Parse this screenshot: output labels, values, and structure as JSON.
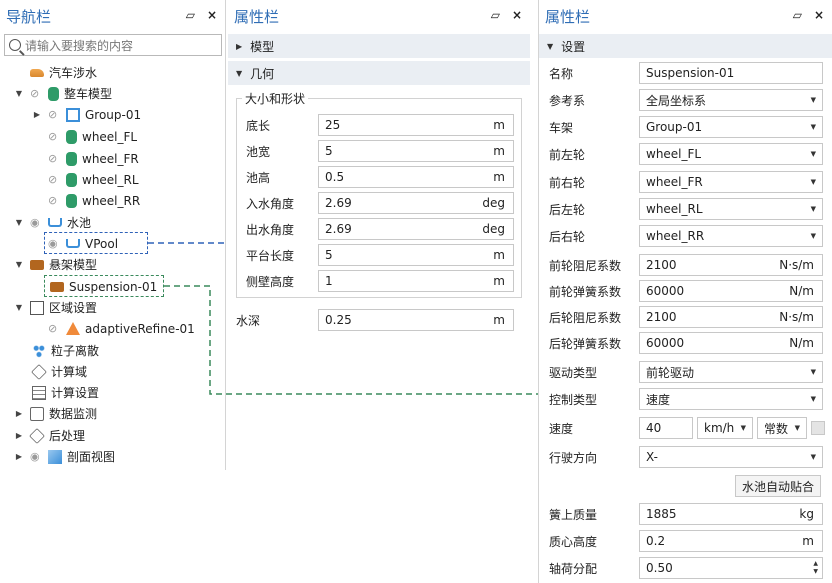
{
  "nav": {
    "title": "导航栏",
    "pin_icon": "pin-icon",
    "close_label": "×",
    "search_placeholder": "请输入要搜索的内容",
    "items": [
      {
        "label": "汽车涉水",
        "icon": "car-icon"
      },
      {
        "label": "整车模型",
        "icon": "vehicle-icon"
      },
      {
        "label": "Group-01",
        "icon": "group-icon"
      },
      {
        "label": "wheel_FL",
        "icon": "wheel-icon"
      },
      {
        "label": "wheel_FR",
        "icon": "wheel-icon"
      },
      {
        "label": "wheel_RL",
        "icon": "wheel-icon"
      },
      {
        "label": "wheel_RR",
        "icon": "wheel-icon"
      },
      {
        "label": "水池",
        "icon": "pool-icon"
      },
      {
        "label": "VPool",
        "icon": "pool-icon"
      },
      {
        "label": "悬架模型",
        "icon": "suspension-icon"
      },
      {
        "label": "Suspension-01",
        "icon": "suspension-icon"
      },
      {
        "label": "区域设置",
        "icon": "region-icon"
      },
      {
        "label": "adaptiveRefine-01",
        "icon": "refine-icon"
      },
      {
        "label": "粒子离散",
        "icon": "particle-icon"
      },
      {
        "label": "计算域",
        "icon": "domain-icon"
      },
      {
        "label": "计算设置",
        "icon": "settings-icon"
      },
      {
        "label": "数据监测",
        "icon": "monitor-icon"
      },
      {
        "label": "后处理",
        "icon": "postprocess-icon"
      },
      {
        "label": "剖面视图",
        "icon": "section-icon"
      }
    ]
  },
  "prop1": {
    "title": "属性栏",
    "close_label": "×",
    "section_model": "模型",
    "section_geometry": "几何",
    "group_title": "大小和形状",
    "rows": [
      {
        "label": "底长",
        "value": "25",
        "unit": "m"
      },
      {
        "label": "池宽",
        "value": "5",
        "unit": "m"
      },
      {
        "label": "池高",
        "value": "0.5",
        "unit": "m"
      },
      {
        "label": "入水角度",
        "value": "2.69",
        "unit": "deg"
      },
      {
        "label": "出水角度",
        "value": "2.69",
        "unit": "deg"
      },
      {
        "label": "平台长度",
        "value": "5",
        "unit": "m"
      },
      {
        "label": "侧壁高度",
        "value": "1",
        "unit": "m"
      }
    ],
    "water_depth": {
      "label": "水深",
      "value": "0.25",
      "unit": "m"
    }
  },
  "prop2": {
    "title": "属性栏",
    "close_label": "×",
    "section": "设置",
    "rows": [
      {
        "label": "名称",
        "value": "Suspension-01",
        "kind": "text"
      },
      {
        "label": "参考系",
        "value": "全局坐标系",
        "kind": "select"
      },
      {
        "label": "车架",
        "value": "Group-01",
        "kind": "select"
      },
      {
        "label": "前左轮",
        "value": "wheel_FL",
        "kind": "select"
      },
      {
        "label": "前右轮",
        "value": "wheel_FR",
        "kind": "select"
      },
      {
        "label": "后左轮",
        "value": "wheel_RL",
        "kind": "select"
      },
      {
        "label": "后右轮",
        "value": "wheel_RR",
        "kind": "select"
      },
      {
        "label": "前轮阻尼系数",
        "value": "2100",
        "unit": "N·s/m",
        "kind": "unit"
      },
      {
        "label": "前轮弹簧系数",
        "value": "60000",
        "unit": "N/m",
        "kind": "unit"
      },
      {
        "label": "后轮阻尼系数",
        "value": "2100",
        "unit": "N·s/m",
        "kind": "unit"
      },
      {
        "label": "后轮弹簧系数",
        "value": "60000",
        "unit": "N/m",
        "kind": "unit"
      },
      {
        "label": "驱动类型",
        "value": "前轮驱动",
        "kind": "select"
      },
      {
        "label": "控制类型",
        "value": "速度",
        "kind": "select"
      }
    ],
    "speed": {
      "label": "速度",
      "value": "40",
      "unit": "km/h",
      "mode": "常数"
    },
    "direction": {
      "label": "行驶方向",
      "value": "X-"
    },
    "auto_fit_button": "水池自动贴合",
    "sprung_mass": {
      "label": "簧上质量",
      "value": "1885",
      "unit": "kg"
    },
    "cog_height": {
      "label": "质心高度",
      "value": "0.2",
      "unit": "m"
    },
    "load_distribution": {
      "label": "轴荷分配",
      "value": "0.50"
    }
  },
  "colors": {
    "title_blue": "#2f6db5",
    "highlight_blue": "#2f62b8",
    "highlight_green": "#3a8a5c"
  }
}
